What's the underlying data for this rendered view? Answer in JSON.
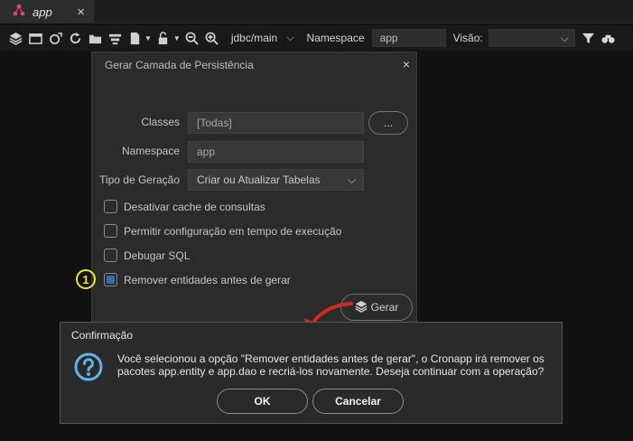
{
  "tab": {
    "label": "app",
    "close": "×"
  },
  "toolbar": {
    "datasource": "jdbc/main",
    "namespace_label": "Namespace",
    "namespace_value": "app",
    "view_label": "Visão:",
    "view_value": ""
  },
  "dialog": {
    "title": "Gerar Camada de Persistência",
    "close": "×",
    "classes_label": "Classes",
    "classes_value": "[Todas]",
    "classes_button": "...",
    "namespace_label": "Namespace",
    "namespace_value": "app",
    "type_label": "Tipo de Geração",
    "type_value": "Criar ou Atualizar Tabelas",
    "options": [
      {
        "label": "Desativar cache de consultas",
        "checked": false
      },
      {
        "label": "Permitir configuração em tempo de execução",
        "checked": false
      },
      {
        "label": "Debugar SQL",
        "checked": false
      },
      {
        "label": "Remover entidades antes de gerar",
        "checked": true
      }
    ],
    "generate_label": "Gerar"
  },
  "annotation": {
    "number": "1"
  },
  "confirm": {
    "title": "Confirmação",
    "message": "Você selecionou a opção \"Remover entidades antes de gerar\", o Cronapp irá remover os pacotes app.entity e app.dao e recriá-los novamente. Deseja continuar com a operação?",
    "ok": "OK",
    "cancel": "Cancelar"
  },
  "colors": {
    "accent": "#e8ea3a",
    "arrow": "#d42a1e",
    "question": "#5db4e8",
    "checkbox_checked": "#3a6aa7"
  }
}
